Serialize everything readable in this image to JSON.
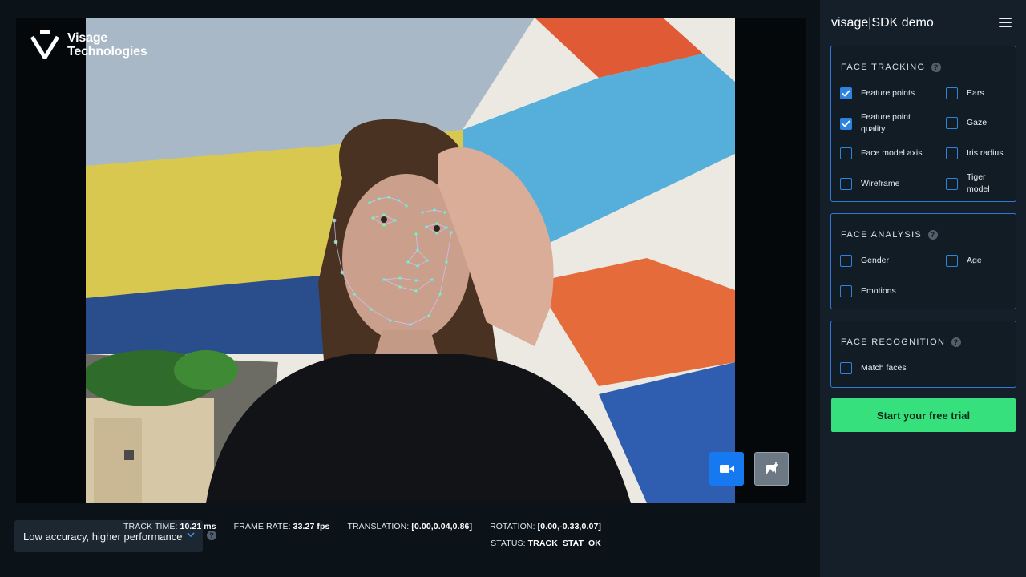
{
  "brand": {
    "line1": "Visage",
    "line2": "Technologies"
  },
  "video": {
    "camera_icon": "video-camera-icon",
    "image_icon": "add-image-icon"
  },
  "mode": {
    "label": "Low accuracy, higher performance",
    "help": "?"
  },
  "stats": {
    "track_time_label": "TRACK TIME:",
    "track_time": "10.21 ms",
    "frame_rate_label": "FRAME RATE:",
    "frame_rate": "33.27 fps",
    "translation_label": "TRANSLATION:",
    "translation": "[0.00,0.04,0.86]",
    "rotation_label": "ROTATION:",
    "rotation": "[0.00,-0.33,0.07]",
    "status_label": "STATUS:",
    "status": "TRACK_STAT_OK"
  },
  "sidebar": {
    "title": "visage|SDK demo",
    "face_tracking": {
      "title": "FACE TRACKING",
      "help": "?",
      "options": [
        {
          "label": "Feature points",
          "checked": true
        },
        {
          "label": "Ears",
          "checked": false
        },
        {
          "label": "Feature point quality",
          "checked": true
        },
        {
          "label": "Gaze",
          "checked": false
        },
        {
          "label": "Face model axis",
          "checked": false
        },
        {
          "label": "Iris radius",
          "checked": false
        },
        {
          "label": "Wireframe",
          "checked": false
        },
        {
          "label": "Tiger model",
          "checked": false
        }
      ]
    },
    "face_analysis": {
      "title": "FACE ANALYSIS",
      "help": "?",
      "options": [
        {
          "label": "Gender",
          "checked": false
        },
        {
          "label": "Age",
          "checked": false
        },
        {
          "label": "Emotions",
          "checked": false
        }
      ]
    },
    "face_recognition": {
      "title": "FACE RECOGNITION",
      "help": "?",
      "options": [
        {
          "label": "Match faces",
          "checked": false
        }
      ]
    },
    "cta": "Start your free trial"
  },
  "colors": {
    "accent": "#2f83e0",
    "cta": "#35e07d",
    "camera_button": "#1779f0",
    "tracking_points": "#7dff4f"
  }
}
